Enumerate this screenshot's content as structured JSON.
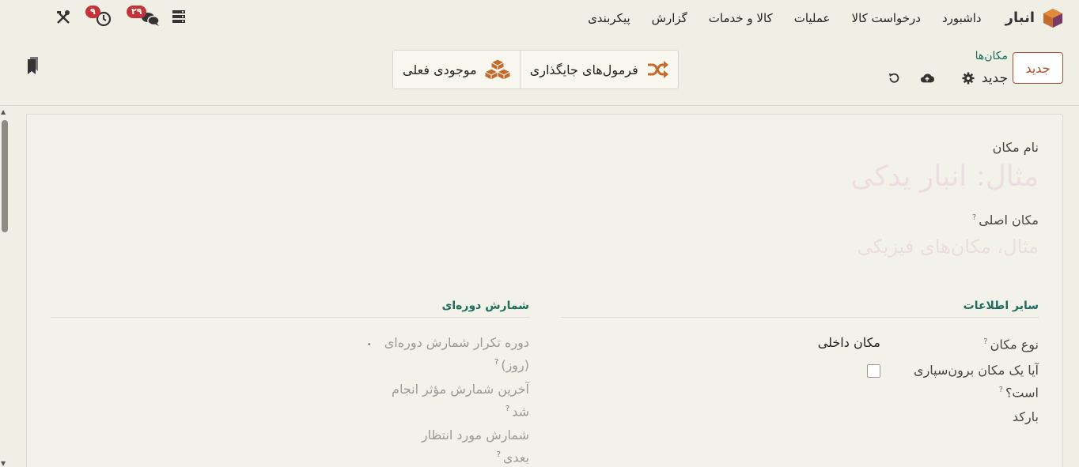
{
  "navbar": {
    "app_name": "انبار",
    "menu": [
      "داشبورد",
      "درخواست کالا",
      "عملیات",
      "کالا و خدمات",
      "گزارش",
      "پیکربندی"
    ],
    "messages_badge": "۲۹",
    "activities_badge": "۹"
  },
  "control_panel": {
    "new_button": "جدید",
    "breadcrumb_parent": "مکان‌ها",
    "breadcrumb_current": "جدید",
    "smart_buttons": [
      "فرمول‌های جایگذاری",
      "موجودی فعلی"
    ]
  },
  "form": {
    "name_label": "نام مکان",
    "name_placeholder": "مثال: انبار یدکی",
    "parent_label": "مکان اصلی",
    "parent_placeholder": "مثال، مکان‌های فیزیکی",
    "help_mark": "?",
    "section_other": "سایر اطلاعات",
    "section_cycle": "شمارش دوره‌ای",
    "location_type_label": "نوع مکان",
    "location_type_value": "مکان داخلی",
    "outsourcing_label_1": "آیا یک مکان برون‌سپاری",
    "outsourcing_label_2": "است؟",
    "barcode_label": "بارکد",
    "cycle_freq_label_1": "دوره تکرار شمارش دوره‌ای",
    "cycle_freq_label_2": "(روز)",
    "cycle_freq_value": "۰",
    "last_count_label_1": "آخرین شمارش مؤثر انجام",
    "last_count_label_2": "شد",
    "next_count_label_1": "شمارش مورد انتظار",
    "next_count_label_2": "بعدی"
  },
  "colors": {
    "accent": "#a9502b",
    "teal": "#1d6d5c",
    "badge": "#c2343a"
  }
}
